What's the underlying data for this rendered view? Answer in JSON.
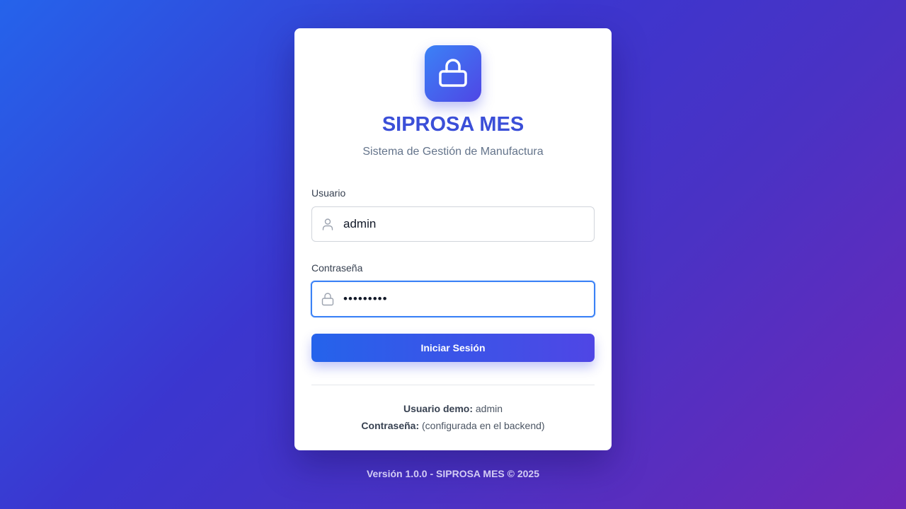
{
  "app": {
    "title": "SIPROSA MES",
    "subtitle": "Sistema de Gestión de Manufactura",
    "logo_icon": "lock-icon"
  },
  "form": {
    "username_label": "Usuario",
    "username_value": "admin",
    "username_icon": "user-icon",
    "password_label": "Contraseña",
    "password_value": "•••••••••",
    "password_icon": "lock-icon",
    "submit_label": "Iniciar Sesión"
  },
  "demo": {
    "user_label": "Usuario demo:",
    "user_value": "admin",
    "password_label": "Contraseña:",
    "password_value": "(configurada en el backend)"
  },
  "footer": {
    "text": "Versión 1.0.0 - SIPROSA MES © 2025"
  },
  "colors": {
    "accent": "#3b4fd8",
    "button_start": "#2563eb",
    "button_end": "#4f46e5",
    "focus_border": "#3b82f6"
  }
}
